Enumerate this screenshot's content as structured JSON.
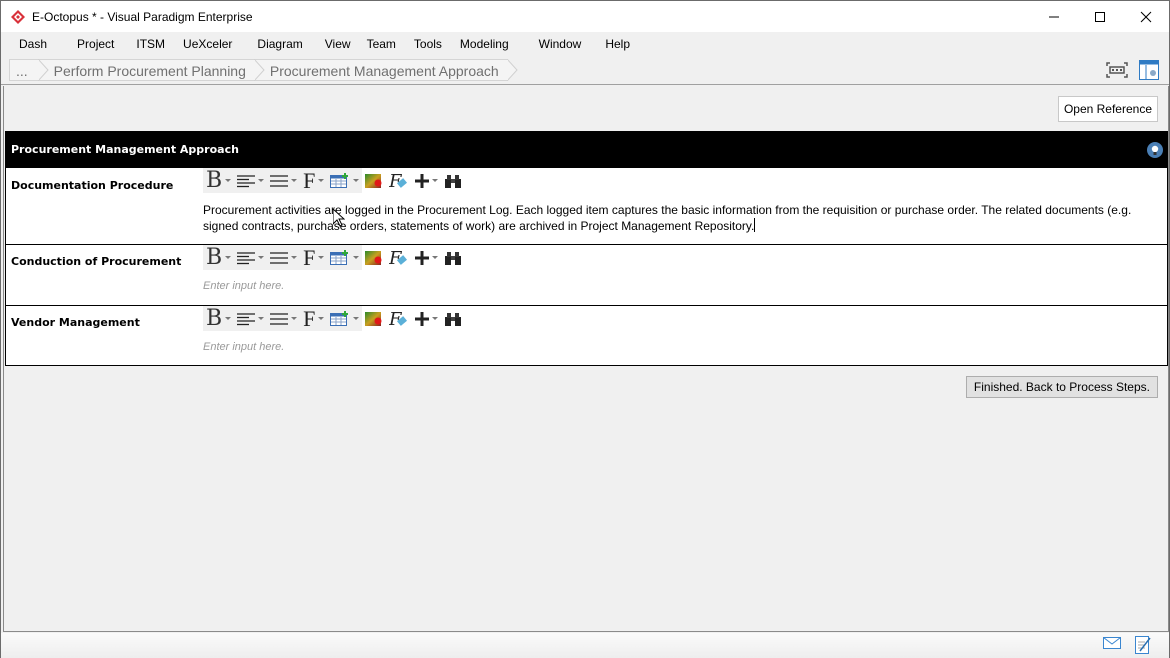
{
  "window": {
    "title": "E-Octopus * - Visual Paradigm Enterprise",
    "controls": [
      "minimize",
      "maximize",
      "close"
    ]
  },
  "menu": [
    "Dash",
    "Project",
    "ITSM",
    "UeXceler",
    "Diagram",
    "View",
    "Team",
    "Tools",
    "Modeling",
    "Window",
    "Help"
  ],
  "breadcrumb": {
    "items": [
      "...",
      "Perform Procurement Planning",
      "Procurement Management Approach"
    ]
  },
  "toolbar_right": {
    "icons": [
      "fit-screen-icon",
      "panel-layout-icon"
    ]
  },
  "main": {
    "open_reference_label": "Open Reference",
    "section": {
      "title": "Procurement Management Approach",
      "rows": [
        {
          "label": "Documentation Procedure",
          "text": "Procurement activities are logged in the Procurement Log. Each logged item captures the basic information from the requisition or purchase order. The related documents (e.g. signed contracts, purchase orders, statements of work) are archived in Project Management Repository.",
          "is_placeholder": false
        },
        {
          "label": "Conduction of Procurement",
          "text": "Enter input here.",
          "is_placeholder": true
        },
        {
          "label": "Vendor Management",
          "text": "Enter input here.",
          "is_placeholder": true
        }
      ]
    },
    "finish_label": "Finished. Back to Process Steps."
  },
  "editor_toolbar": {
    "bold_glyph": "B",
    "font_glyph": "F",
    "tools": [
      "bold",
      "align",
      "list",
      "font",
      "table",
      "color",
      "format",
      "insert",
      "find"
    ]
  },
  "status_icons": [
    "mail-icon",
    "notes-icon"
  ],
  "colors": {
    "app_icon": "#d9313a",
    "section_header_bg": "#000000",
    "hint_icon": "#4a7fb5"
  }
}
